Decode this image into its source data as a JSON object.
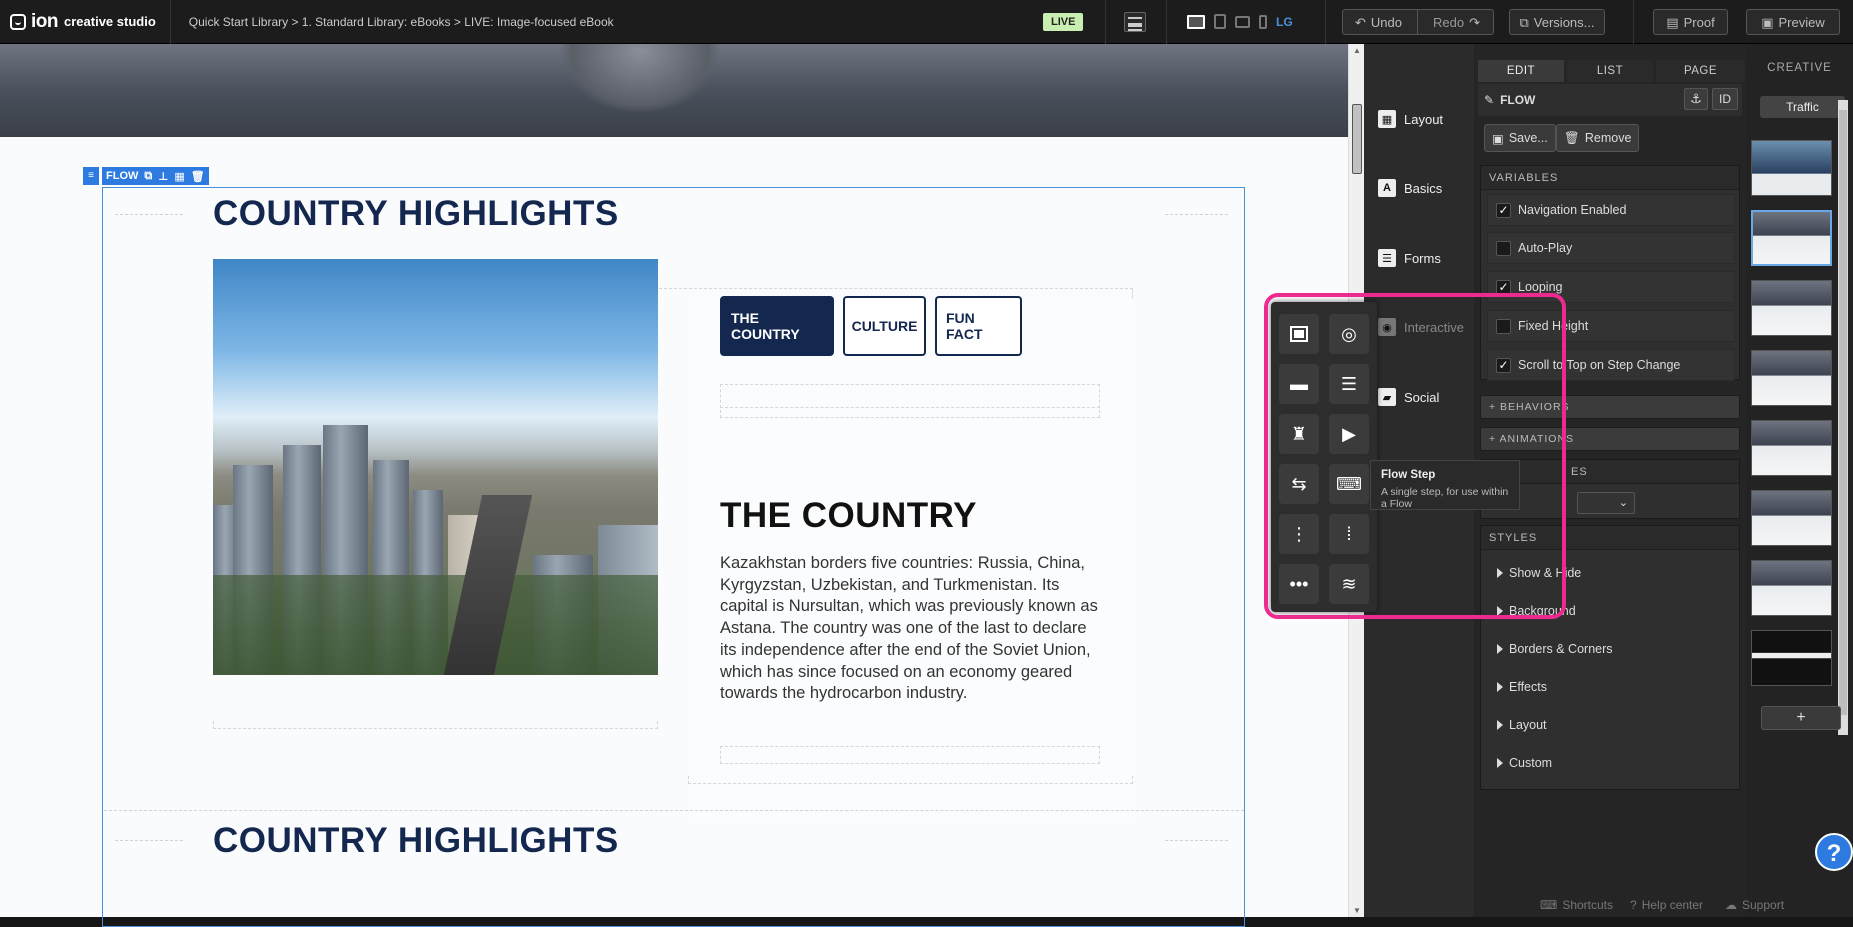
{
  "app": {
    "logo_text": "ion",
    "product": "creative studio"
  },
  "breadcrumb": {
    "text": "Quick Start Library > 1. Standard Library: eBooks > LIVE: Image-focused eBook"
  },
  "status": {
    "live": "LIVE"
  },
  "devices": {
    "size_label": "LG"
  },
  "toolbar": {
    "undo": "Undo",
    "redo": "Redo",
    "versions": "Versions...",
    "proof": "Proof",
    "preview": "Preview"
  },
  "flow_tag": {
    "label": "FLOW"
  },
  "content": {
    "heading_1": "COUNTRY HIGHLIGHTS",
    "heading_2": "COUNTRY HIGHLIGHTS",
    "tabs": [
      "THE COUNTRY",
      "CULTURE",
      "FUN FACT"
    ],
    "section_title": "THE COUNTRY",
    "body": "Kazakhstan borders five countries: Russia, China, Kyrgyzstan, Uzbekistan, and Turkmenistan. Its capital is Nursultan, which was previously known as Astana. The country was one of the last to declare its independence after the end of the Soviet Union, which has since focused on an economy geared towards the hydrocarbon industry."
  },
  "left_panel": {
    "items": [
      "Layout",
      "Basics",
      "Forms",
      "Interactive",
      "Social"
    ]
  },
  "props": {
    "tabs": [
      "EDIT",
      "LIST",
      "PAGE"
    ],
    "header": "FLOW",
    "id_label": "ID",
    "save": "Save...",
    "remove": "Remove",
    "variables_title": "VARIABLES",
    "variables": [
      {
        "label": "Navigation Enabled",
        "checked": true
      },
      {
        "label": "Auto-Play",
        "checked": false
      },
      {
        "label": "Looping",
        "checked": true
      },
      {
        "label": "Fixed Height",
        "checked": false
      },
      {
        "label": "Scroll to Top on Step Change",
        "checked": true
      }
    ],
    "behaviors": "+ BEHAVIORS",
    "animations": "+ ANIMATIONS",
    "partial_section": "ES",
    "styles_title": "STYLES",
    "styles": [
      "Show & Hide",
      "Background",
      "Borders & Corners",
      "Effects",
      "Layout",
      "Custom"
    ]
  },
  "thumbs_panel": {
    "title": "CREATIVE",
    "traffic": "Traffic",
    "add": "+"
  },
  "tooltip": {
    "title": "Flow Step",
    "desc": "A single step, for use within a Flow"
  },
  "footer": {
    "shortcuts": "Shortcuts",
    "help": "Help center",
    "support": "Support"
  },
  "help_button": "?",
  "colors": {
    "accent": "#2d7be0",
    "navy": "#13274f",
    "highlight": "#ee2a8e",
    "live": "#c8efb1"
  },
  "popup_icons": [
    "frame-icon",
    "preview-eye-icon",
    "folder-icon",
    "text-lines-icon",
    "robot-icon",
    "play-icon",
    "flow-step-icon",
    "keyboard-step-icon",
    "dot-marker-icon",
    "vertical-dots-icon",
    "horizontal-dots-icon",
    "layers-icon"
  ]
}
